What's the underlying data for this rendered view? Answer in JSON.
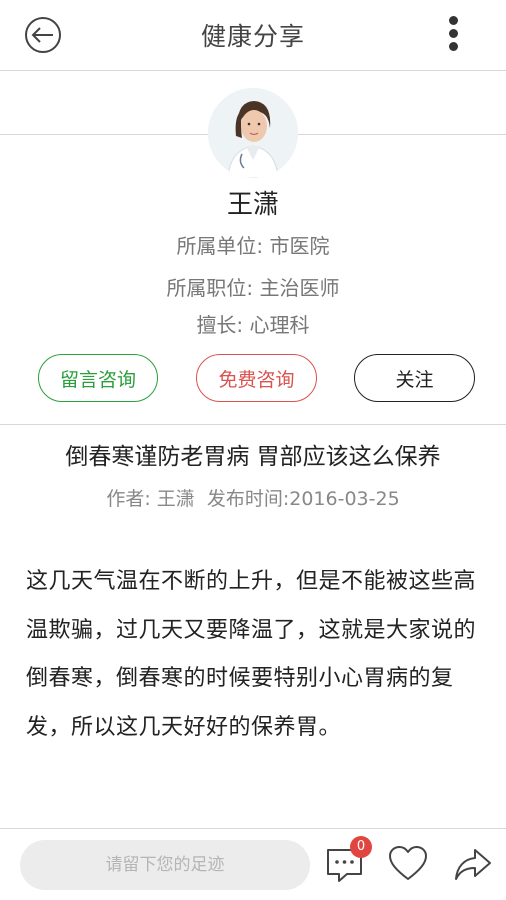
{
  "header": {
    "title": "健康分享",
    "back_icon": "back-arrow-icon",
    "more_icon": "more-vertical-icon"
  },
  "doctor": {
    "name": "王潇",
    "unit": "所属单位: 市医院",
    "position": "所属职位: 主治医师",
    "specialty": "擅长: 心理科"
  },
  "actions": {
    "message_consult": "留言咨询",
    "free_consult": "免费咨询",
    "follow": "关注"
  },
  "article": {
    "title": "倒春寒谨防老胃病 胃部应该这么保养",
    "meta": "作者: 王潇  发布时间:2016-03-25",
    "body": "这几天气温在不断的上升，但是不能被这些高温欺骗，过几天又要降温了，这就是大家说的倒春寒，倒春寒的时候要特别小心胃病的复发，所以这几天好好的保养胃。"
  },
  "bottom_bar": {
    "comment_placeholder": "请留下您的足迹",
    "comment_count": "0",
    "comment_icon": "comment-icon",
    "like_icon": "heart-icon",
    "share_icon": "share-icon"
  },
  "colors": {
    "green": "#2aa03c",
    "red": "#d9534f",
    "badge": "#e0463f"
  }
}
